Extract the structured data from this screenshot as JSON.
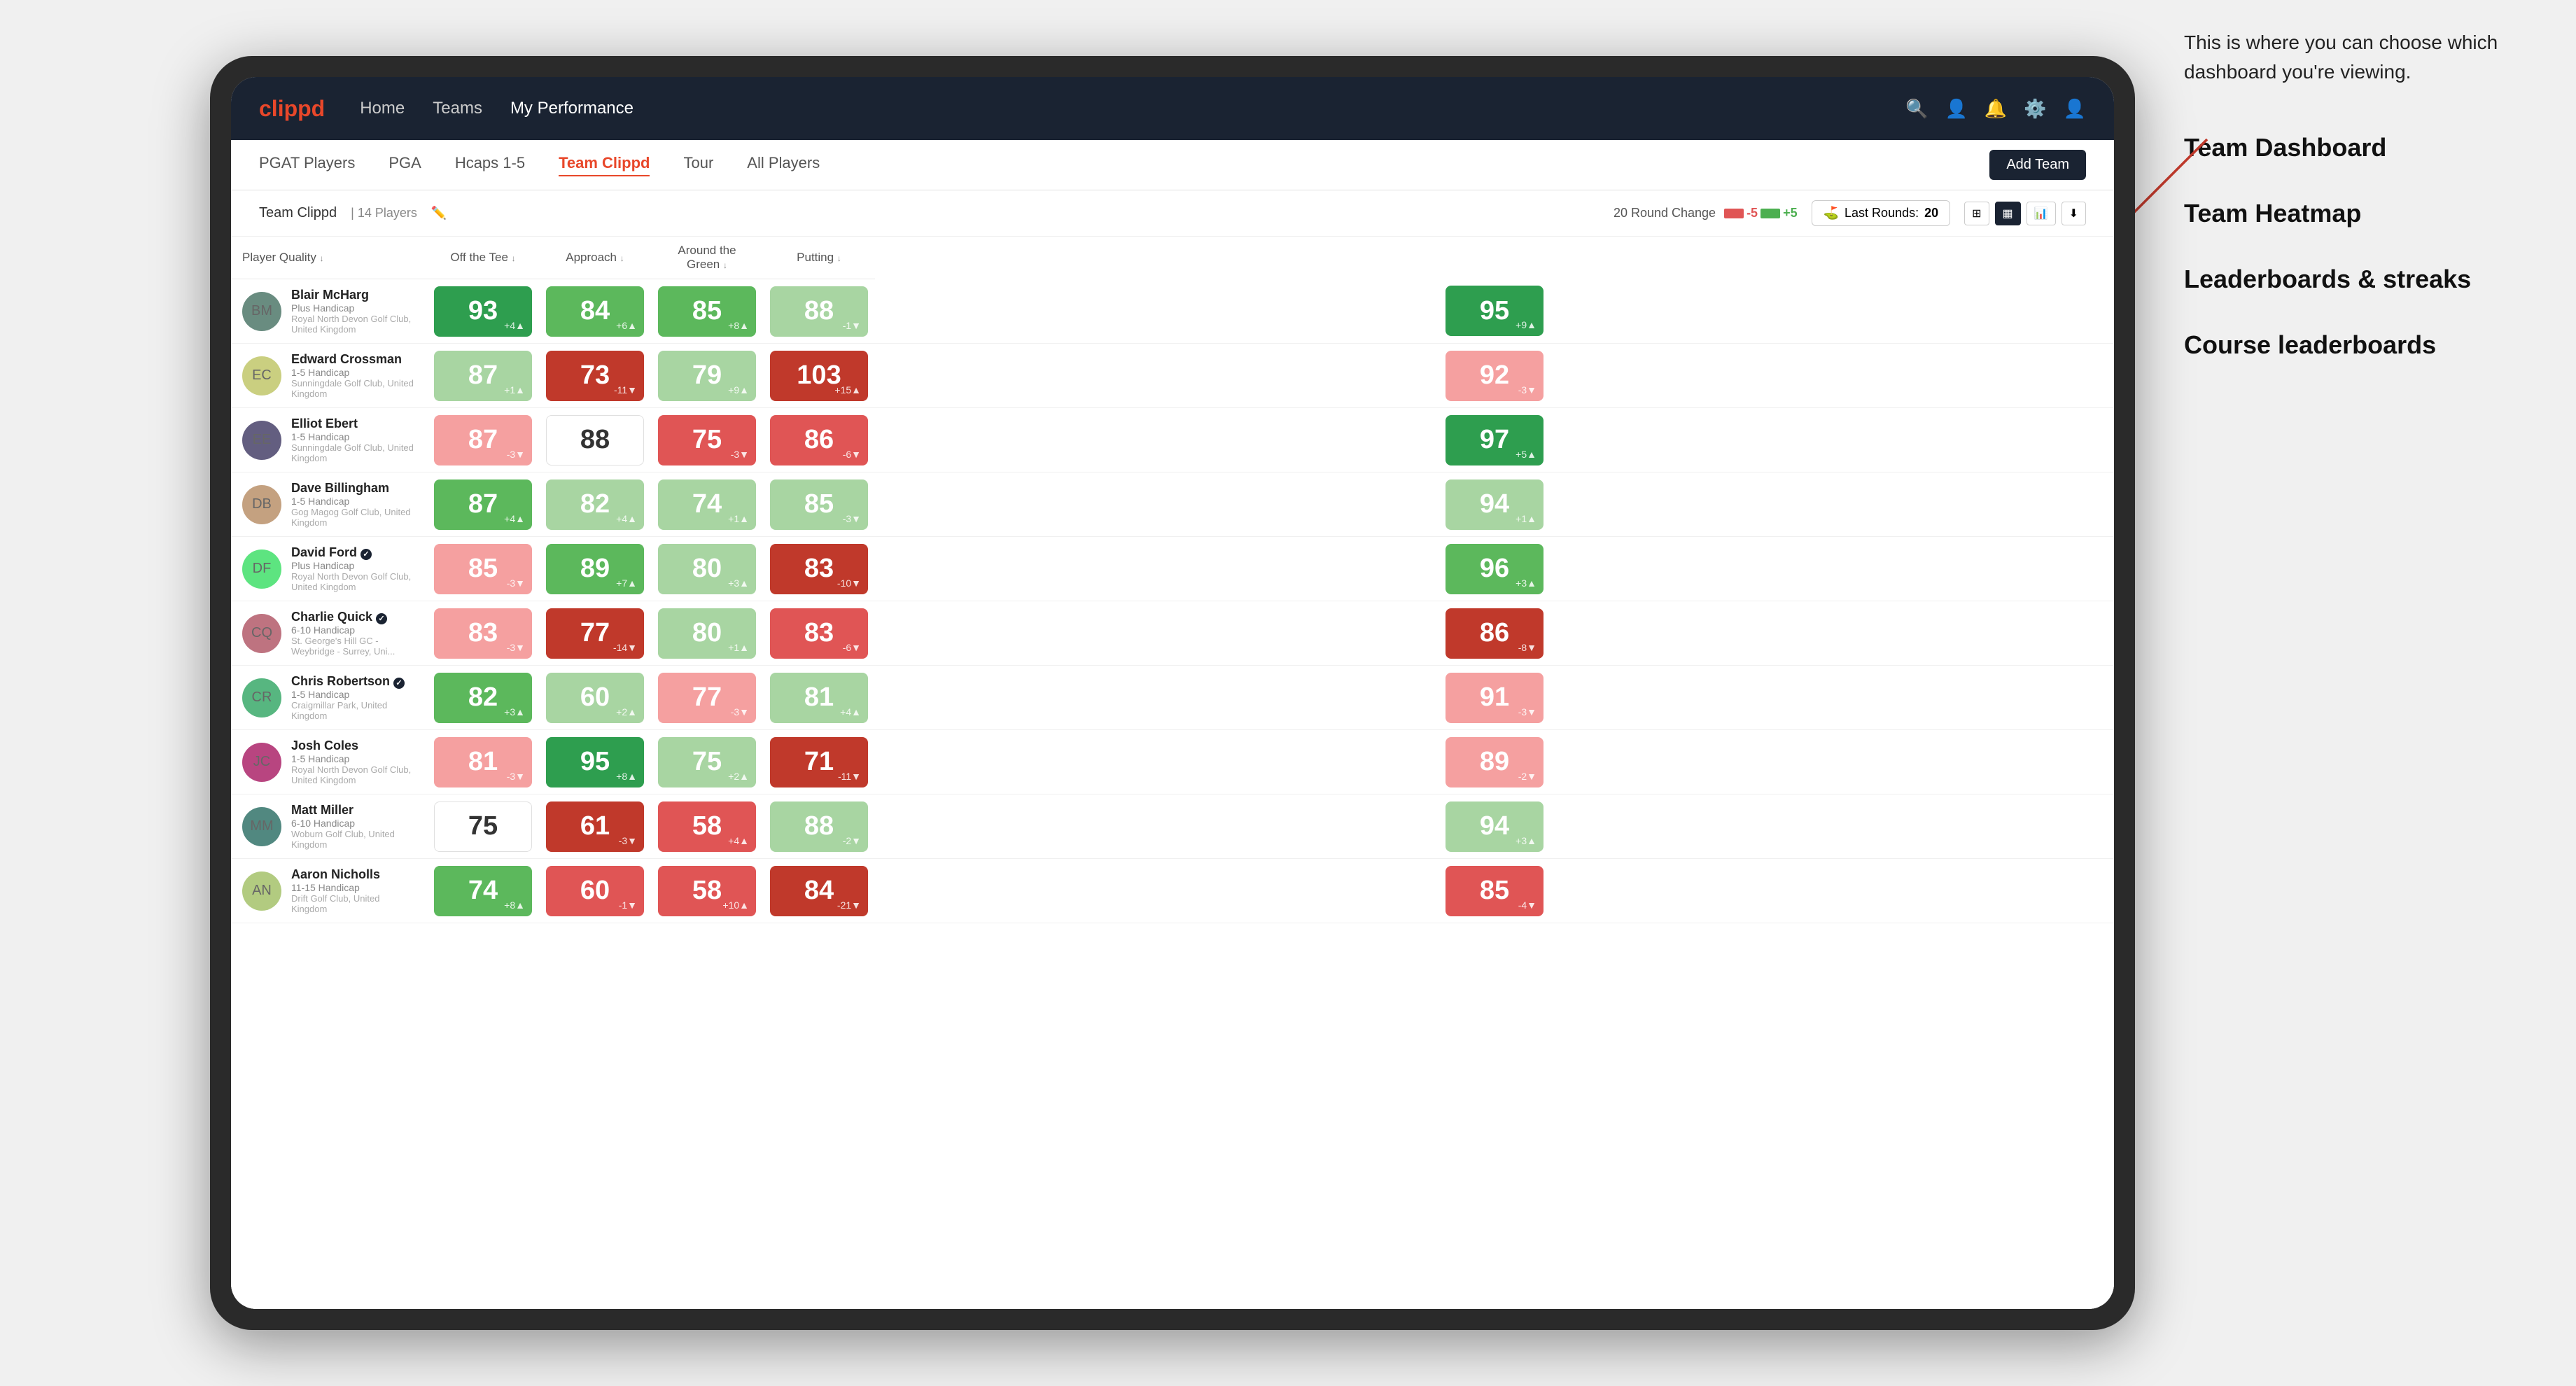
{
  "annotation": {
    "intro_text": "This is where you can choose which dashboard you're viewing.",
    "items": [
      "Team Dashboard",
      "Team Heatmap",
      "Leaderboards & streaks",
      "Course leaderboards"
    ]
  },
  "navbar": {
    "logo": "clippd",
    "links": [
      "Home",
      "Teams",
      "My Performance"
    ],
    "active_link": "My Performance"
  },
  "subnav": {
    "links": [
      "PGAT Players",
      "PGA",
      "Hcaps 1-5",
      "Team Clippd",
      "Tour",
      "All Players"
    ],
    "active_link": "Team Clippd",
    "add_team_label": "Add Team"
  },
  "team_header": {
    "name": "Team Clippd",
    "separator": "|",
    "count": "14 Players",
    "round_change_label": "20 Round Change",
    "change_neg": "-5",
    "change_pos": "+5",
    "last_rounds_label": "Last Rounds:",
    "last_rounds_value": "20"
  },
  "table": {
    "columns": [
      {
        "key": "player",
        "label": "Player Quality",
        "arrow": "↓"
      },
      {
        "key": "off_tee",
        "label": "Off the Tee",
        "arrow": "↓"
      },
      {
        "key": "approach",
        "label": "Approach",
        "arrow": "↓"
      },
      {
        "key": "around_green",
        "label": "Around the Green",
        "arrow": "↓"
      },
      {
        "key": "putting",
        "label": "Putting",
        "arrow": "↓"
      }
    ],
    "rows": [
      {
        "name": "Blair McHarg",
        "handicap": "Plus Handicap",
        "club": "Royal North Devon Golf Club, United Kingdom",
        "scores": [
          {
            "value": 93,
            "change": "+4",
            "dir": "up",
            "color": "green-dark"
          },
          {
            "value": 84,
            "change": "+6",
            "dir": "up",
            "color": "green-mid"
          },
          {
            "value": 85,
            "change": "+8",
            "dir": "up",
            "color": "green-mid"
          },
          {
            "value": 88,
            "change": "-1",
            "dir": "down",
            "color": "green-light"
          },
          {
            "value": 95,
            "change": "+9",
            "dir": "up",
            "color": "green-dark"
          }
        ]
      },
      {
        "name": "Edward Crossman",
        "handicap": "1-5 Handicap",
        "club": "Sunningdale Golf Club, United Kingdom",
        "scores": [
          {
            "value": 87,
            "change": "+1",
            "dir": "up",
            "color": "green-light"
          },
          {
            "value": 73,
            "change": "-11",
            "dir": "down",
            "color": "red-dark"
          },
          {
            "value": 79,
            "change": "+9",
            "dir": "up",
            "color": "green-light"
          },
          {
            "value": 103,
            "change": "+15",
            "dir": "up",
            "color": "red-dark"
          },
          {
            "value": 92,
            "change": "-3",
            "dir": "down",
            "color": "red-light"
          }
        ]
      },
      {
        "name": "Elliot Ebert",
        "handicap": "1-5 Handicap",
        "club": "Sunningdale Golf Club, United Kingdom",
        "scores": [
          {
            "value": 87,
            "change": "-3",
            "dir": "down",
            "color": "red-light"
          },
          {
            "value": 88,
            "change": "",
            "dir": "",
            "color": "white"
          },
          {
            "value": 75,
            "change": "-3",
            "dir": "down",
            "color": "red-mid"
          },
          {
            "value": 86,
            "change": "-6",
            "dir": "down",
            "color": "red-mid"
          },
          {
            "value": 97,
            "change": "+5",
            "dir": "up",
            "color": "green-dark"
          }
        ]
      },
      {
        "name": "Dave Billingham",
        "handicap": "1-5 Handicap",
        "club": "Gog Magog Golf Club, United Kingdom",
        "scores": [
          {
            "value": 87,
            "change": "+4",
            "dir": "up",
            "color": "green-mid"
          },
          {
            "value": 82,
            "change": "+4",
            "dir": "up",
            "color": "green-light"
          },
          {
            "value": 74,
            "change": "+1",
            "dir": "up",
            "color": "green-light"
          },
          {
            "value": 85,
            "change": "-3",
            "dir": "down",
            "color": "green-light"
          },
          {
            "value": 94,
            "change": "+1",
            "dir": "up",
            "color": "green-light"
          }
        ]
      },
      {
        "name": "David Ford",
        "handicap": "Plus Handicap",
        "club": "Royal North Devon Golf Club, United Kingdom",
        "has_badge": true,
        "scores": [
          {
            "value": 85,
            "change": "-3",
            "dir": "down",
            "color": "red-light"
          },
          {
            "value": 89,
            "change": "+7",
            "dir": "up",
            "color": "green-mid"
          },
          {
            "value": 80,
            "change": "+3",
            "dir": "up",
            "color": "green-light"
          },
          {
            "value": 83,
            "change": "-10",
            "dir": "down",
            "color": "red-dark"
          },
          {
            "value": 96,
            "change": "+3",
            "dir": "up",
            "color": "green-mid"
          }
        ]
      },
      {
        "name": "Charlie Quick",
        "handicap": "6-10 Handicap",
        "club": "St. George's Hill GC - Weybridge - Surrey, Uni...",
        "has_badge": true,
        "scores": [
          {
            "value": 83,
            "change": "-3",
            "dir": "down",
            "color": "red-light"
          },
          {
            "value": 77,
            "change": "-14",
            "dir": "down",
            "color": "red-dark"
          },
          {
            "value": 80,
            "change": "+1",
            "dir": "up",
            "color": "green-light"
          },
          {
            "value": 83,
            "change": "-6",
            "dir": "down",
            "color": "red-mid"
          },
          {
            "value": 86,
            "change": "-8",
            "dir": "down",
            "color": "red-dark"
          }
        ]
      },
      {
        "name": "Chris Robertson",
        "handicap": "1-5 Handicap",
        "club": "Craigmillar Park, United Kingdom",
        "has_badge": true,
        "scores": [
          {
            "value": 82,
            "change": "+3",
            "dir": "up",
            "color": "green-mid"
          },
          {
            "value": 60,
            "change": "+2",
            "dir": "up",
            "color": "green-light"
          },
          {
            "value": 77,
            "change": "-3",
            "dir": "down",
            "color": "red-light"
          },
          {
            "value": 81,
            "change": "+4",
            "dir": "up",
            "color": "green-light"
          },
          {
            "value": 91,
            "change": "-3",
            "dir": "down",
            "color": "red-light"
          }
        ]
      },
      {
        "name": "Josh Coles",
        "handicap": "1-5 Handicap",
        "club": "Royal North Devon Golf Club, United Kingdom",
        "scores": [
          {
            "value": 81,
            "change": "-3",
            "dir": "down",
            "color": "red-light"
          },
          {
            "value": 95,
            "change": "+8",
            "dir": "up",
            "color": "green-dark"
          },
          {
            "value": 75,
            "change": "+2",
            "dir": "up",
            "color": "green-light"
          },
          {
            "value": 71,
            "change": "-11",
            "dir": "down",
            "color": "red-dark"
          },
          {
            "value": 89,
            "change": "-2",
            "dir": "down",
            "color": "red-light"
          }
        ]
      },
      {
        "name": "Matt Miller",
        "handicap": "6-10 Handicap",
        "club": "Woburn Golf Club, United Kingdom",
        "scores": [
          {
            "value": 75,
            "change": "",
            "dir": "",
            "color": "white"
          },
          {
            "value": 61,
            "change": "-3",
            "dir": "down",
            "color": "red-dark"
          },
          {
            "value": 58,
            "change": "+4",
            "dir": "up",
            "color": "red-mid"
          },
          {
            "value": 88,
            "change": "-2",
            "dir": "down",
            "color": "green-light"
          },
          {
            "value": 94,
            "change": "+3",
            "dir": "up",
            "color": "green-light"
          }
        ]
      },
      {
        "name": "Aaron Nicholls",
        "handicap": "11-15 Handicap",
        "club": "Drift Golf Club, United Kingdom",
        "scores": [
          {
            "value": 74,
            "change": "+8",
            "dir": "up",
            "color": "green-mid"
          },
          {
            "value": 60,
            "change": "-1",
            "dir": "down",
            "color": "red-mid"
          },
          {
            "value": 58,
            "change": "+10",
            "dir": "up",
            "color": "red-mid"
          },
          {
            "value": 84,
            "change": "-21",
            "dir": "down",
            "color": "red-dark"
          },
          {
            "value": 85,
            "change": "-4",
            "dir": "down",
            "color": "red-mid"
          }
        ]
      }
    ]
  }
}
